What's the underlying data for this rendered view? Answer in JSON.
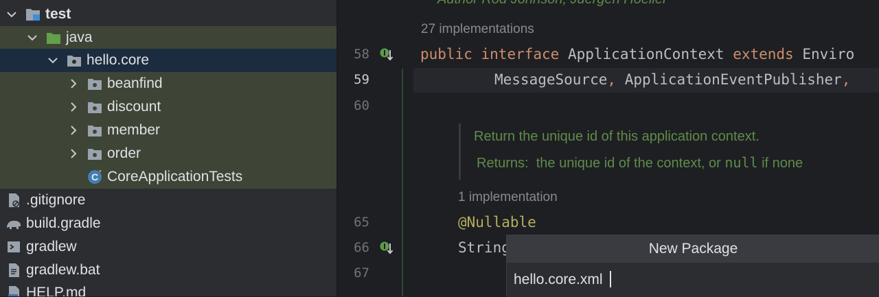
{
  "project_tree": {
    "items": [
      {
        "label": "test",
        "icon": "test-folder-icon"
      },
      {
        "label": "java",
        "icon": "source-folder-icon"
      },
      {
        "label": "hello.core",
        "icon": "package-icon"
      },
      {
        "label": "beanfind",
        "icon": "package-icon"
      },
      {
        "label": "discount",
        "icon": "package-icon"
      },
      {
        "label": "member",
        "icon": "package-icon"
      },
      {
        "label": "order",
        "icon": "package-icon"
      },
      {
        "label": "CoreApplicationTests",
        "icon": "test-class-icon"
      },
      {
        "label": ".gitignore",
        "icon": "gitignore-file-icon"
      },
      {
        "label": "build.gradle",
        "icon": "gradle-elephant-icon"
      },
      {
        "label": "gradlew",
        "icon": "shell-script-icon"
      },
      {
        "label": "gradlew.bat",
        "icon": "text-file-icon"
      },
      {
        "label": "HELP.md",
        "icon": "markdown-file-icon"
      }
    ]
  },
  "gutter": {
    "line_numbers": [
      "58",
      "59",
      "60",
      "65",
      "66",
      "67"
    ],
    "icon": "implemented-interface-icon"
  },
  "editor": {
    "top_text": "Author    Rod Johnson, Juergen Hoeller",
    "hint_1": "27 implementations",
    "line58": {
      "kw_public": "public",
      "kw_interface": "interface",
      "name": "ApplicationContext",
      "kw_extends": "extends",
      "rest": "Enviro"
    },
    "line59": {
      "text1": "MessageSource",
      "comma1": ",",
      "text2": "ApplicationEventPublisher",
      "comma2": ","
    },
    "doc_line1": "Return the unique id of this application context.",
    "doc_returns_label": "Returns:",
    "doc_returns_a": "the unique id of the context, or",
    "doc_returns_null": "null",
    "doc_returns_b": "if none",
    "hint_2": "1 implementation",
    "line65": "@Nullable",
    "line66": "String"
  },
  "popup": {
    "title": "New Package",
    "value": "hello.core.xml"
  },
  "colors": {
    "keyword": "#cf8e6d",
    "annotation": "#b3ae60",
    "doc_comment": "#5f8c4a",
    "selection": "#1c2c3f",
    "tinted_row": "#3e4536"
  }
}
